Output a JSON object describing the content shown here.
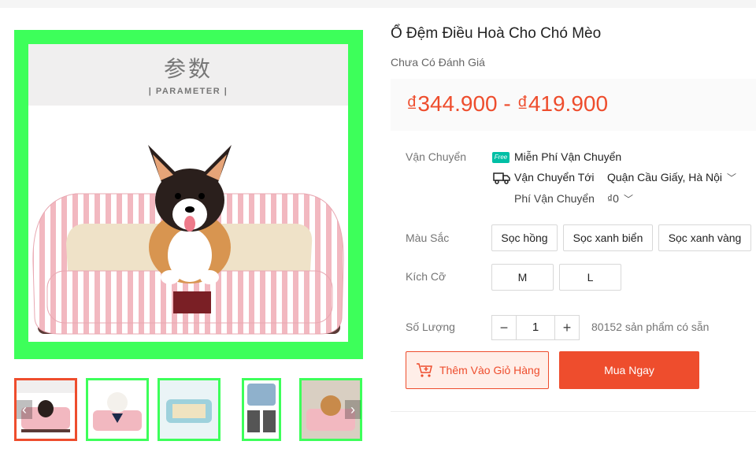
{
  "product": {
    "title": "Ổ Đệm Điều Hoà Cho Chó Mèo",
    "rating_text": "Chưa Có Đánh Giá",
    "price_range": "₫344.900 - ₫419.900"
  },
  "gallery": {
    "banner_cn": "参数",
    "banner_en": "| PARAMETER |",
    "thumbnails": [
      "thumb-1",
      "thumb-2",
      "thumb-3",
      "thumb-4",
      "thumb-5"
    ],
    "active_index": 0
  },
  "shipping": {
    "label": "Vận Chuyển",
    "free_badge": "Free",
    "free_text": "Miễn Phí Vận Chuyển",
    "to_label": "Vận Chuyển Tới",
    "destination": "Quận Cầu Giấy, Hà Nội",
    "fee_label": "Phí Vận Chuyển",
    "fee_value": "₫0"
  },
  "color": {
    "label": "Màu Sắc",
    "options": [
      "Sọc hồng",
      "Sọc xanh biển",
      "Sọc xanh vàng"
    ]
  },
  "size": {
    "label": "Kích Cỡ",
    "options": [
      "M",
      "L"
    ]
  },
  "quantity": {
    "label": "Số Lượng",
    "minus": "−",
    "value": "1",
    "plus": "+",
    "stock": "80152 sản phẩm có sẵn"
  },
  "actions": {
    "add_to_cart": "Thêm Vào Giỏ Hàng",
    "buy_now": "Mua Ngay"
  },
  "colors": {
    "accent": "#ee4d2d",
    "frame_green": "#3dff5a",
    "free_badge": "#00bfa5"
  }
}
